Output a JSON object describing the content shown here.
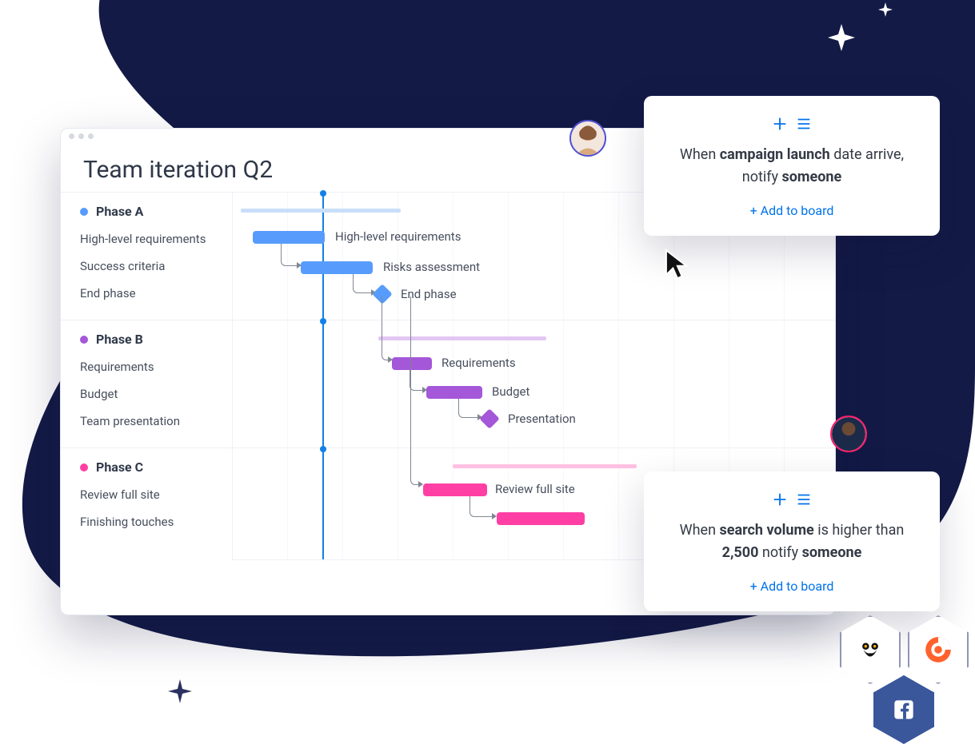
{
  "window": {
    "title": "Team iteration Q2"
  },
  "phases": [
    {
      "name": "Phase A",
      "color": "#579cfc",
      "tasks": [
        {
          "label": "High-level requirements",
          "bar_label": "High-level requirements"
        },
        {
          "label": "Success criteria",
          "bar_label": "Risks assessment"
        },
        {
          "label": "End phase",
          "bar_label": "End phase"
        }
      ]
    },
    {
      "name": "Phase B",
      "color": "#a457d8",
      "tasks": [
        {
          "label": "Requirements",
          "bar_label": "Requirements"
        },
        {
          "label": "Budget",
          "bar_label": "Budget"
        },
        {
          "label": "Team presentation",
          "bar_label": "Presentation"
        }
      ]
    },
    {
      "name": "Phase C",
      "color": "#ff3fa4",
      "tasks": [
        {
          "label": "Review full site",
          "bar_label": "Review full site"
        },
        {
          "label": "Finishing touches",
          "bar_label": ""
        }
      ]
    }
  ],
  "card1": {
    "text_pre": "When ",
    "bold1": "campaign launch",
    "mid": " date arrive, notify ",
    "bold2": "someone",
    "action": "+ Add to board"
  },
  "card2": {
    "text_pre": "When ",
    "bold1": "search volume",
    "mid1": " is higher than ",
    "bold2": "2,500",
    "mid2": " notify ",
    "bold3": "someone",
    "action": "+ Add to board"
  },
  "badges": {
    "hootsuite": "hootsuite-icon",
    "semrush": "semrush-icon",
    "facebook": "facebook-icon"
  },
  "chart_data": {
    "type": "gantt",
    "title": "Team iteration Q2",
    "today_col": 1.5,
    "col_width_days": 1,
    "groups": [
      {
        "name": "Phase A",
        "color": "#579cfc",
        "summary": {
          "start": 0,
          "end": 3
        },
        "tasks": [
          {
            "name": "High-level requirements",
            "start": 0.3,
            "end": 1.6
          },
          {
            "name": "Risks assessment",
            "start": 1.2,
            "end": 2.5
          },
          {
            "name": "End phase",
            "type": "milestone",
            "at": 2.6
          }
        ]
      },
      {
        "name": "Phase B",
        "color": "#a457d8",
        "summary": {
          "start": 2.6,
          "end": 5
        },
        "tasks": [
          {
            "name": "Requirements",
            "start": 2.8,
            "end": 3.5
          },
          {
            "name": "Budget",
            "start": 3.4,
            "end": 4.4
          },
          {
            "name": "Presentation",
            "type": "milestone",
            "at": 4.5
          }
        ]
      },
      {
        "name": "Phase C",
        "color": "#ff3fa4",
        "summary": {
          "start": 4.0,
          "end": 7
        },
        "tasks": [
          {
            "name": "Review full site",
            "start": 3.5,
            "end": 4.6
          },
          {
            "name": "Finishing touches",
            "start": 4.8,
            "end": 6.4
          }
        ]
      }
    ]
  }
}
